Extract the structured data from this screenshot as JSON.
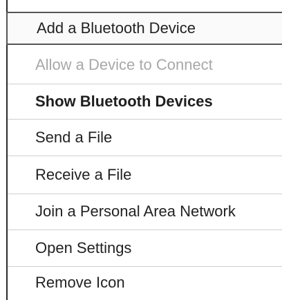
{
  "context_menu": {
    "items": [
      {
        "label": "Add a Bluetooth Device",
        "state": "highlighted"
      },
      {
        "label": "Allow a Device to Connect",
        "state": "disabled"
      },
      {
        "label": "Show Bluetooth Devices",
        "state": "default-bold"
      },
      {
        "label": "Send a File",
        "state": "normal"
      },
      {
        "label": "Receive a File",
        "state": "normal"
      },
      {
        "label": "Join a Personal Area Network",
        "state": "normal"
      },
      {
        "label": "Open Settings",
        "state": "normal"
      },
      {
        "label": "Remove Icon",
        "state": "normal"
      }
    ]
  },
  "colors": {
    "text": "#222222",
    "disabled_text": "#a8a8a8",
    "separator": "#cfcfcf",
    "highlight_border": "#555555",
    "menu_border": "#2b2b2b",
    "background": "#ffffff"
  }
}
